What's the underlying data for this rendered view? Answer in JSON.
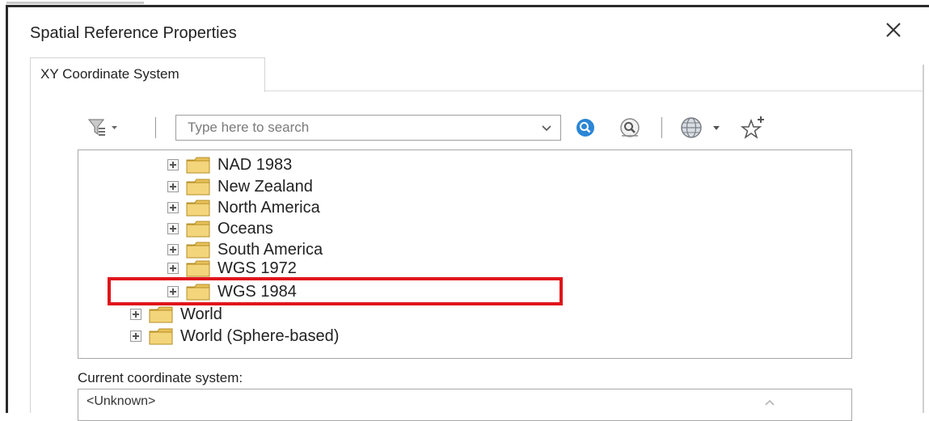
{
  "dialog": {
    "title": "Spatial Reference Properties",
    "close_icon": "close-icon"
  },
  "tabs": [
    {
      "label": "XY Coordinate System",
      "selected": true
    }
  ],
  "toolbar": {
    "filter_icon": "filter-icon",
    "search_placeholder": "Type here to search",
    "search_value": "",
    "search_icon": "search-icon",
    "advanced_search_icon": "advanced-search-icon",
    "globe_icon": "globe-icon",
    "favorite_icon": "add-to-favorites-icon"
  },
  "tree": {
    "items": [
      {
        "label": "NAD 1983",
        "level": 2
      },
      {
        "label": "New Zealand",
        "level": 2
      },
      {
        "label": "North America",
        "level": 2
      },
      {
        "label": "Oceans",
        "level": 2
      },
      {
        "label": "South America",
        "level": 2
      },
      {
        "label": "WGS 1972",
        "level": 2
      },
      {
        "label": "WGS 1984",
        "level": 2,
        "highlighted": true
      },
      {
        "label": "World",
        "level": 1
      },
      {
        "label": "World (Sphere-based)",
        "level": 1
      }
    ],
    "highlight_color": "#e0151b",
    "folder_color": "#e8c15a"
  },
  "current": {
    "label": "Current coordinate system:",
    "value": "<Unknown>"
  }
}
